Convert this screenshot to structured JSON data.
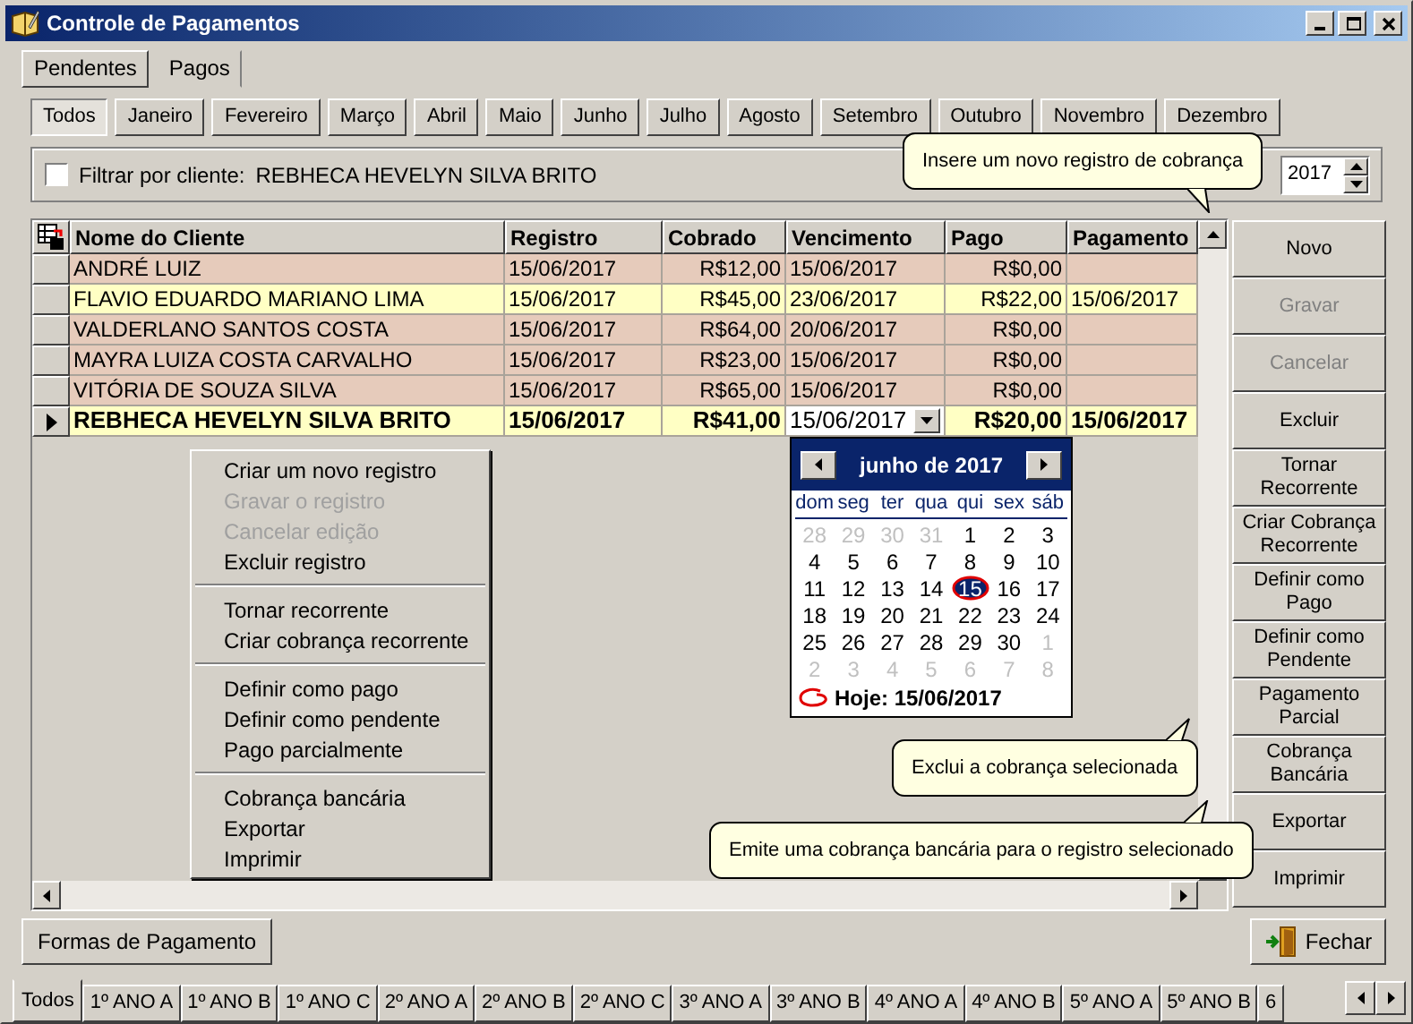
{
  "window": {
    "title": "Controle de Pagamentos"
  },
  "top_tabs": [
    {
      "label": "Pendentes",
      "selected": true
    },
    {
      "label": "Pagos",
      "selected": false
    }
  ],
  "month_tabs": [
    {
      "label": "Todos",
      "selected": true
    },
    {
      "label": "Janeiro",
      "selected": false
    },
    {
      "label": "Fevereiro",
      "selected": false
    },
    {
      "label": "Março",
      "selected": false
    },
    {
      "label": "Abril",
      "selected": false
    },
    {
      "label": "Maio",
      "selected": false
    },
    {
      "label": "Junho",
      "selected": false
    },
    {
      "label": "Julho",
      "selected": false
    },
    {
      "label": "Agosto",
      "selected": false
    },
    {
      "label": "Setembro",
      "selected": false
    },
    {
      "label": "Outubro",
      "selected": false
    },
    {
      "label": "Novembro",
      "selected": false
    },
    {
      "label": "Dezembro",
      "selected": false
    }
  ],
  "filter": {
    "checked": false,
    "label": "Filtrar por cliente:",
    "value": "REBHECA HEVELYN SILVA BRITO"
  },
  "year": "2017",
  "table": {
    "columns": [
      "Nome do Cliente",
      "Registro",
      "Cobrado",
      "Vencimento",
      "Pago",
      "Pagamento"
    ],
    "rows": [
      {
        "selected": false,
        "color": "#e6cbbb",
        "cells": [
          "ANDRÉ LUIZ",
          "15/06/2017",
          "R$12,00",
          "15/06/2017",
          "R$0,00",
          ""
        ]
      },
      {
        "selected": false,
        "color": "#ffffc4",
        "cells": [
          "FLAVIO EDUARDO MARIANO LIMA",
          "15/06/2017",
          "R$45,00",
          "23/06/2017",
          "R$22,00",
          "15/06/2017"
        ]
      },
      {
        "selected": false,
        "color": "#e6cbbb",
        "cells": [
          "VALDERLANO SANTOS COSTA",
          "15/06/2017",
          "R$64,00",
          "20/06/2017",
          "R$0,00",
          ""
        ]
      },
      {
        "selected": false,
        "color": "#e6cbbb",
        "cells": [
          "MAYRA LUIZA COSTA CARVALHO",
          "15/06/2017",
          "R$23,00",
          "15/06/2017",
          "R$0,00",
          ""
        ]
      },
      {
        "selected": false,
        "color": "#e6cbbb",
        "cells": [
          "VITÓRIA DE SOUZA SILVA",
          "15/06/2017",
          "R$65,00",
          "15/06/2017",
          "R$0,00",
          ""
        ]
      },
      {
        "selected": true,
        "color": "#ffffc4",
        "cells": [
          "REBHECA HEVELYN SILVA BRITO",
          "15/06/2017",
          "R$41,00",
          "15/06/2017",
          "R$20,00",
          "15/06/2017"
        ]
      }
    ]
  },
  "context_menu": {
    "groups": [
      [
        {
          "label": "Criar um novo registro",
          "disabled": false
        },
        {
          "label": "Gravar o registro",
          "disabled": true
        },
        {
          "label": "Cancelar edição",
          "disabled": true
        },
        {
          "label": "Excluir registro",
          "disabled": false
        }
      ],
      [
        {
          "label": "Tornar recorrente",
          "disabled": false
        },
        {
          "label": "Criar cobrança recorrente",
          "disabled": false
        }
      ],
      [
        {
          "label": "Definir como pago",
          "disabled": false
        },
        {
          "label": "Definir como pendente",
          "disabled": false
        },
        {
          "label": "Pago parcialmente",
          "disabled": false
        }
      ],
      [
        {
          "label": "Cobrança bancária",
          "disabled": false
        },
        {
          "label": "Exportar",
          "disabled": false
        },
        {
          "label": "Imprimir",
          "disabled": false
        }
      ]
    ]
  },
  "calendar": {
    "month_label": "junho de 2017",
    "weekdays": [
      "dom",
      "seg",
      "ter",
      "qua",
      "qui",
      "sex",
      "sáb"
    ],
    "weeks": [
      [
        {
          "day": "28",
          "outside": true,
          "selected": false
        },
        {
          "day": "29",
          "outside": true,
          "selected": false
        },
        {
          "day": "30",
          "outside": true,
          "selected": false
        },
        {
          "day": "31",
          "outside": true,
          "selected": false
        },
        {
          "day": "1",
          "outside": false,
          "selected": false
        },
        {
          "day": "2",
          "outside": false,
          "selected": false
        },
        {
          "day": "3",
          "outside": false,
          "selected": false
        }
      ],
      [
        {
          "day": "4",
          "outside": false,
          "selected": false
        },
        {
          "day": "5",
          "outside": false,
          "selected": false
        },
        {
          "day": "6",
          "outside": false,
          "selected": false
        },
        {
          "day": "7",
          "outside": false,
          "selected": false
        },
        {
          "day": "8",
          "outside": false,
          "selected": false
        },
        {
          "day": "9",
          "outside": false,
          "selected": false
        },
        {
          "day": "10",
          "outside": false,
          "selected": false
        }
      ],
      [
        {
          "day": "11",
          "outside": false,
          "selected": false
        },
        {
          "day": "12",
          "outside": false,
          "selected": false
        },
        {
          "day": "13",
          "outside": false,
          "selected": false
        },
        {
          "day": "14",
          "outside": false,
          "selected": false
        },
        {
          "day": "15",
          "outside": false,
          "selected": true
        },
        {
          "day": "16",
          "outside": false,
          "selected": false
        },
        {
          "day": "17",
          "outside": false,
          "selected": false
        }
      ],
      [
        {
          "day": "18",
          "outside": false,
          "selected": false
        },
        {
          "day": "19",
          "outside": false,
          "selected": false
        },
        {
          "day": "20",
          "outside": false,
          "selected": false
        },
        {
          "day": "21",
          "outside": false,
          "selected": false
        },
        {
          "day": "22",
          "outside": false,
          "selected": false
        },
        {
          "day": "23",
          "outside": false,
          "selected": false
        },
        {
          "day": "24",
          "outside": false,
          "selected": false
        }
      ],
      [
        {
          "day": "25",
          "outside": false,
          "selected": false
        },
        {
          "day": "26",
          "outside": false,
          "selected": false
        },
        {
          "day": "27",
          "outside": false,
          "selected": false
        },
        {
          "day": "28",
          "outside": false,
          "selected": false
        },
        {
          "day": "29",
          "outside": false,
          "selected": false
        },
        {
          "day": "30",
          "outside": false,
          "selected": false
        },
        {
          "day": "1",
          "outside": true,
          "selected": false
        }
      ],
      [
        {
          "day": "2",
          "outside": true,
          "selected": false
        },
        {
          "day": "3",
          "outside": true,
          "selected": false
        },
        {
          "day": "4",
          "outside": true,
          "selected": false
        },
        {
          "day": "5",
          "outside": true,
          "selected": false
        },
        {
          "day": "6",
          "outside": true,
          "selected": false
        },
        {
          "day": "7",
          "outside": true,
          "selected": false
        },
        {
          "day": "8",
          "outside": true,
          "selected": false
        }
      ]
    ],
    "today_label": "Hoje: 15/06/2017"
  },
  "side_buttons": [
    {
      "lines": [
        "Novo"
      ],
      "disabled": false
    },
    {
      "lines": [
        "Gravar"
      ],
      "disabled": true
    },
    {
      "lines": [
        "Cancelar"
      ],
      "disabled": true
    },
    {
      "lines": [
        "Excluir"
      ],
      "disabled": false
    },
    {
      "lines": [
        "Tornar",
        "Recorrente"
      ],
      "disabled": false
    },
    {
      "lines": [
        "Criar Cobrança",
        "Recorrente"
      ],
      "disabled": false
    },
    {
      "lines": [
        "Definir como",
        "Pago"
      ],
      "disabled": false
    },
    {
      "lines": [
        "Definir como",
        "Pendente"
      ],
      "disabled": false
    },
    {
      "lines": [
        "Pagamento",
        "Parcial"
      ],
      "disabled": false
    },
    {
      "lines": [
        "Cobrança",
        "Bancária"
      ],
      "disabled": false
    },
    {
      "lines": [
        "Exportar"
      ],
      "disabled": false
    },
    {
      "lines": [
        "Imprimir"
      ],
      "disabled": false
    }
  ],
  "tooltips": [
    {
      "text": "Insere um novo registro de cobrança"
    },
    {
      "text": "Exclui a cobrança selecionada"
    },
    {
      "text": "Emite uma cobrança bancária para o registro selecionado"
    }
  ],
  "payment_methods_button": "Formas de Pagamento",
  "close_button": "Fechar",
  "class_tabs": [
    {
      "label": "Todos",
      "selected": true
    },
    {
      "label": "1º ANO A",
      "selected": false
    },
    {
      "label": "1º ANO B",
      "selected": false
    },
    {
      "label": "1º ANO C",
      "selected": false
    },
    {
      "label": "2º ANO A",
      "selected": false
    },
    {
      "label": "2º ANO B",
      "selected": false
    },
    {
      "label": "2º ANO C",
      "selected": false
    },
    {
      "label": "3º ANO A",
      "selected": false
    },
    {
      "label": "3º ANO B",
      "selected": false
    },
    {
      "label": "4º ANO A",
      "selected": false
    },
    {
      "label": "4º ANO B",
      "selected": false
    },
    {
      "label": "5º ANO A",
      "selected": false
    },
    {
      "label": "5º ANO B",
      "selected": false
    },
    {
      "label": "6",
      "selected": false
    }
  ]
}
